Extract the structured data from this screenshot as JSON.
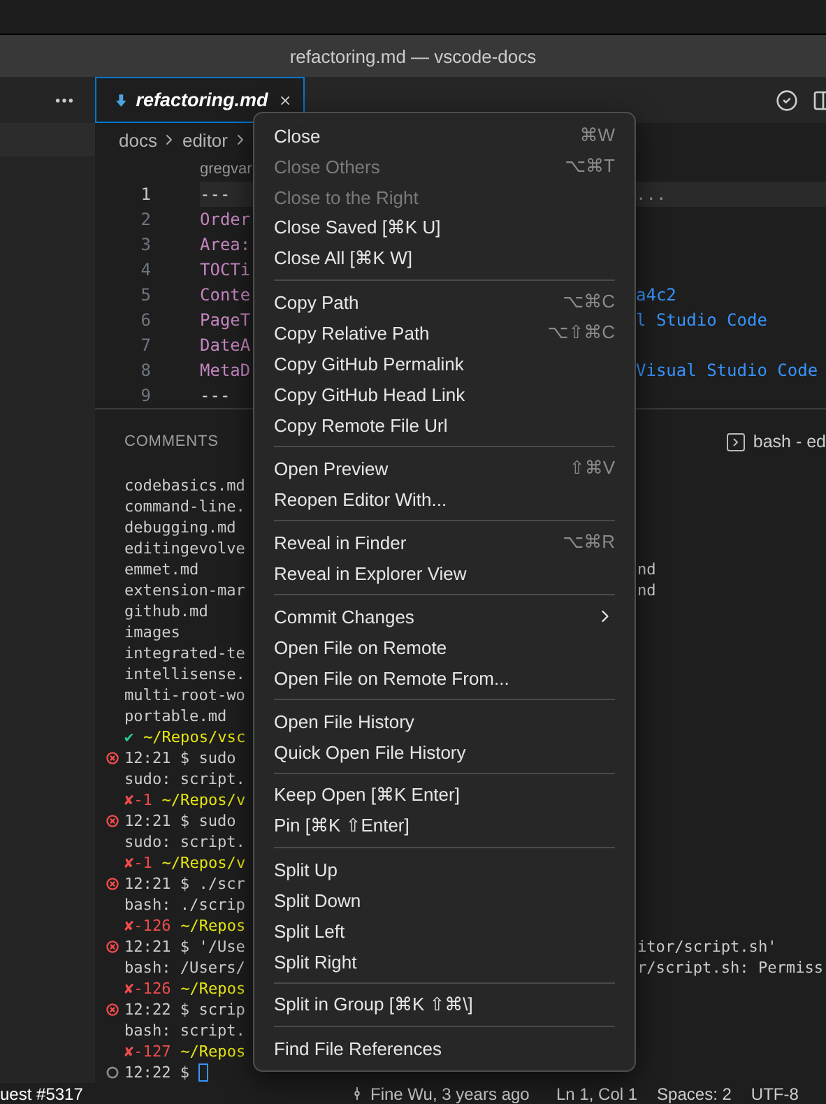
{
  "window": {
    "title": "refactoring.md — vscode-docs"
  },
  "tab": {
    "label": "refactoring.md",
    "selected": true
  },
  "breadcrumbs": [
    "docs",
    "editor"
  ],
  "editor": {
    "codelens": "gregvar",
    "lines": [
      {
        "number": "1",
        "kind": "rule",
        "left": "---",
        "right": "...",
        "current": true
      },
      {
        "number": "2",
        "kind": "key",
        "left": "Order",
        "current": false
      },
      {
        "number": "3",
        "kind": "key",
        "left": "Area:",
        "current": false
      },
      {
        "number": "4",
        "kind": "key",
        "left": "TOCTi",
        "current": false
      },
      {
        "number": "5",
        "kind": "key",
        "left": "Conte",
        "right": "a4c2",
        "current": false
      },
      {
        "number": "6",
        "kind": "key",
        "left": "PageT",
        "right": "l Studio Code",
        "current": false
      },
      {
        "number": "7",
        "kind": "key",
        "left": "DateA",
        "current": false
      },
      {
        "number": "8",
        "kind": "key",
        "left": "MetaD",
        "right": "Visual Studio Code",
        "current": false
      },
      {
        "number": "9",
        "kind": "rule",
        "left": "---",
        "current": false
      }
    ]
  },
  "panel": {
    "tabs": [
      {
        "label": "COMMENTS",
        "selected": false
      }
    ],
    "terminal_label": "bash - ed"
  },
  "terminal": [
    {
      "kind": "output",
      "parts": [
        {
          "kind": "text",
          "text": "codebasics.md"
        }
      ]
    },
    {
      "kind": "output",
      "parts": [
        {
          "kind": "text",
          "text": "command-line."
        }
      ]
    },
    {
      "kind": "output",
      "parts": [
        {
          "kind": "text",
          "text": "debugging.md"
        }
      ]
    },
    {
      "kind": "output",
      "parts": [
        {
          "kind": "text",
          "text": "editingevolve"
        }
      ]
    },
    {
      "kind": "output",
      "parts": [
        {
          "kind": "text",
          "text": "emmet.md"
        }
      ],
      "right": "nd"
    },
    {
      "kind": "output",
      "parts": [
        {
          "kind": "text",
          "text": "extension-mar"
        }
      ],
      "right": "nd"
    },
    {
      "kind": "output",
      "parts": [
        {
          "kind": "text",
          "text": "github.md"
        }
      ]
    },
    {
      "kind": "output",
      "parts": [
        {
          "kind": "text",
          "text": "images"
        }
      ]
    },
    {
      "kind": "output",
      "parts": [
        {
          "kind": "text",
          "text": "integrated-te"
        }
      ]
    },
    {
      "kind": "output",
      "parts": [
        {
          "kind": "text",
          "text": "intellisense."
        }
      ]
    },
    {
      "kind": "output",
      "parts": [
        {
          "kind": "text",
          "text": "multi-root-wo"
        }
      ]
    },
    {
      "kind": "output",
      "parts": [
        {
          "kind": "text",
          "text": "portable.md"
        }
      ]
    },
    {
      "kind": "output",
      "parts": [
        {
          "kind": "ok",
          "text": "✔"
        },
        {
          "kind": "path",
          "text": "~/Repos/vsc"
        }
      ]
    },
    {
      "kind": "error",
      "parts": [
        {
          "kind": "text",
          "text": "12:21 $ sudo"
        }
      ]
    },
    {
      "kind": "output",
      "parts": [
        {
          "kind": "text",
          "text": "sudo: script."
        }
      ]
    },
    {
      "kind": "output",
      "parts": [
        {
          "kind": "exit",
          "text": "✘-1"
        },
        {
          "kind": "path",
          "text": "~/Repos/v"
        }
      ]
    },
    {
      "kind": "error",
      "parts": [
        {
          "kind": "text",
          "text": "12:21 $ sudo"
        }
      ]
    },
    {
      "kind": "output",
      "parts": [
        {
          "kind": "text",
          "text": "sudo: script."
        }
      ]
    },
    {
      "kind": "output",
      "parts": [
        {
          "kind": "exit",
          "text": "✘-1"
        },
        {
          "kind": "path",
          "text": "~/Repos/v"
        }
      ]
    },
    {
      "kind": "error",
      "parts": [
        {
          "kind": "text",
          "text": "12:21 $ ./scr"
        }
      ]
    },
    {
      "kind": "output",
      "parts": [
        {
          "kind": "text",
          "text": "bash: ./scrip"
        }
      ]
    },
    {
      "kind": "output",
      "parts": [
        {
          "kind": "exit",
          "text": "✘-126"
        },
        {
          "kind": "path",
          "text": "~/Repos"
        }
      ]
    },
    {
      "kind": "error",
      "parts": [
        {
          "kind": "text",
          "text": "12:21 $ '/Use"
        }
      ],
      "right": "itor/script.sh'"
    },
    {
      "kind": "output",
      "parts": [
        {
          "kind": "text",
          "text": "bash: /Users/"
        }
      ],
      "right": "r/script.sh: Permiss"
    },
    {
      "kind": "output",
      "parts": [
        {
          "kind": "exit",
          "text": "✘-126"
        },
        {
          "kind": "path",
          "text": "~/Repos"
        }
      ]
    },
    {
      "kind": "error",
      "parts": [
        {
          "kind": "text",
          "text": "12:22 $ scrip"
        }
      ]
    },
    {
      "kind": "output",
      "parts": [
        {
          "kind": "text",
          "text": "bash: script."
        }
      ]
    },
    {
      "kind": "output",
      "parts": [
        {
          "kind": "exit",
          "text": "✘-127"
        },
        {
          "kind": "path",
          "text": "~/Repos"
        }
      ]
    },
    {
      "kind": "idle",
      "parts": [
        {
          "kind": "text",
          "text": "12:22 $"
        },
        {
          "kind": "cursor"
        }
      ]
    }
  ],
  "menu": [
    {
      "kind": "item",
      "label": "Close",
      "shortcut": "⌘W",
      "disabled": false
    },
    {
      "kind": "item",
      "label": "Close Others",
      "shortcut": "⌥⌘T",
      "disabled": true
    },
    {
      "kind": "item",
      "label": "Close to the Right",
      "disabled": true
    },
    {
      "kind": "item",
      "label": "Close Saved [⌘K U]",
      "disabled": false
    },
    {
      "kind": "item",
      "label": "Close All [⌘K W]",
      "disabled": false
    },
    {
      "kind": "separator"
    },
    {
      "kind": "item",
      "label": "Copy Path",
      "shortcut": "⌥⌘C",
      "disabled": false
    },
    {
      "kind": "item",
      "label": "Copy Relative Path",
      "shortcut": "⌥⇧⌘C",
      "disabled": false
    },
    {
      "kind": "item",
      "label": "Copy GitHub Permalink",
      "disabled": false
    },
    {
      "kind": "item",
      "label": "Copy GitHub Head Link",
      "disabled": false
    },
    {
      "kind": "item",
      "label": "Copy Remote File Url",
      "disabled": false
    },
    {
      "kind": "separator"
    },
    {
      "kind": "item",
      "label": "Open Preview",
      "shortcut": "⇧⌘V",
      "disabled": false
    },
    {
      "kind": "item",
      "label": "Reopen Editor With...",
      "disabled": false
    },
    {
      "kind": "separator"
    },
    {
      "kind": "item",
      "label": "Reveal in Finder",
      "shortcut": "⌥⌘R",
      "disabled": false
    },
    {
      "kind": "item",
      "label": "Reveal in Explorer View",
      "disabled": false
    },
    {
      "kind": "separator"
    },
    {
      "kind": "submenu",
      "label": "Commit Changes"
    },
    {
      "kind": "item",
      "label": "Open File on Remote",
      "disabled": false
    },
    {
      "kind": "item",
      "label": "Open File on Remote From...",
      "disabled": false
    },
    {
      "kind": "separator"
    },
    {
      "kind": "item",
      "label": "Open File History",
      "disabled": false
    },
    {
      "kind": "item",
      "label": "Quick Open File History",
      "disabled": false
    },
    {
      "kind": "separator"
    },
    {
      "kind": "item",
      "label": "Keep Open [⌘K Enter]",
      "disabled": false
    },
    {
      "kind": "item",
      "label": "Pin [⌘K ⇧Enter]",
      "disabled": false
    },
    {
      "kind": "separator"
    },
    {
      "kind": "item",
      "label": "Split Up",
      "disabled": false
    },
    {
      "kind": "item",
      "label": "Split Down",
      "disabled": false
    },
    {
      "kind": "item",
      "label": "Split Left",
      "disabled": false
    },
    {
      "kind": "item",
      "label": "Split Right",
      "disabled": false
    },
    {
      "kind": "separator"
    },
    {
      "kind": "item",
      "label": "Split in Group [⌘K ⇧⌘\\]",
      "disabled": false
    },
    {
      "kind": "separator"
    },
    {
      "kind": "item",
      "label": "Find File References",
      "disabled": false
    }
  ],
  "status_bar": {
    "left": "uest #5317",
    "blame": "Fine Wu, 3 years ago",
    "items": [
      "Ln 1, Col 1",
      "Spaces: 2",
      "UTF-8"
    ]
  }
}
